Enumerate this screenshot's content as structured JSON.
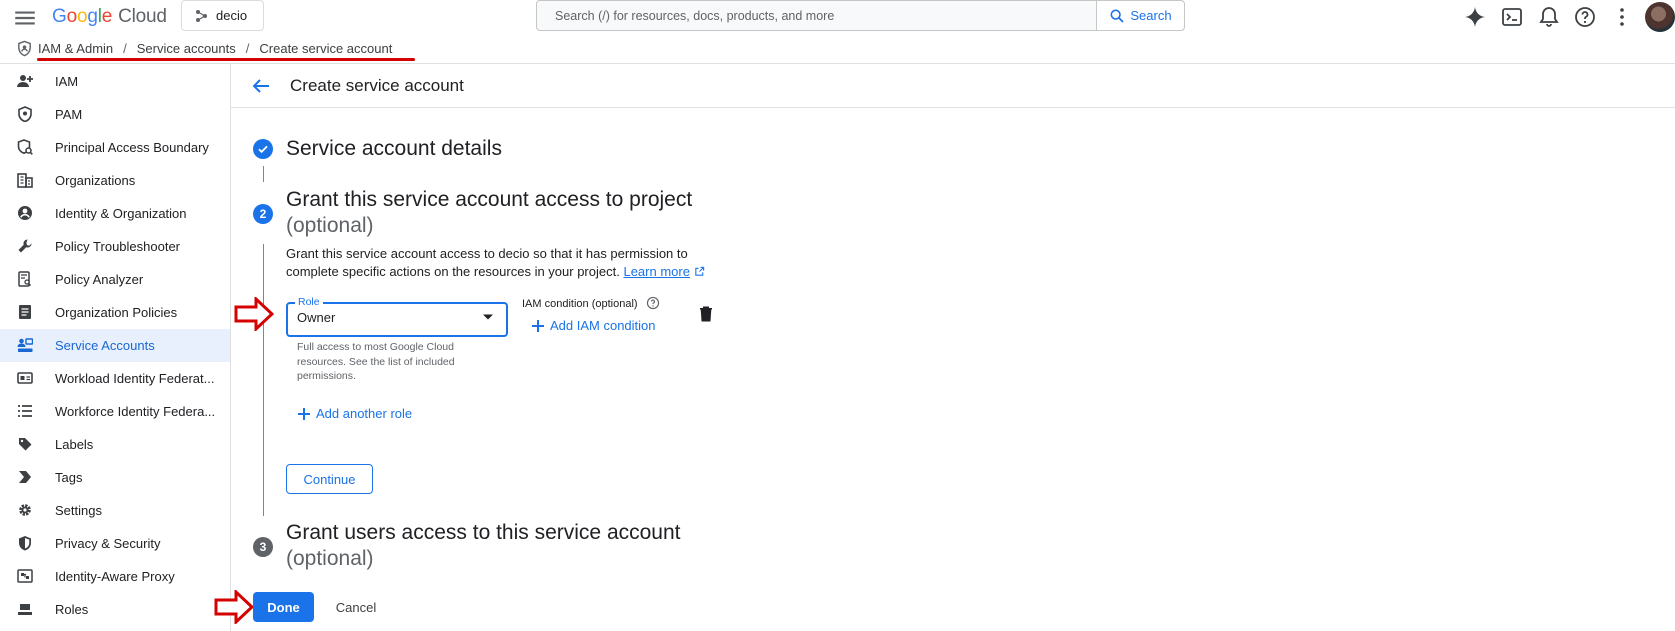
{
  "topbar": {
    "logo_google": [
      "G",
      "o",
      "o",
      "g",
      "l",
      "e"
    ],
    "logo_cloud": "Cloud",
    "project": "decio",
    "search_placeholder": "Search (/) for resources, docs, products, and more",
    "search_button": "Search",
    "icons": [
      "menu-icon",
      "gemini-icon",
      "cloud-shell-icon",
      "notifications-icon",
      "help-icon",
      "more-vert-icon"
    ]
  },
  "breadcrumb": {
    "items": [
      "IAM & Admin",
      "Service accounts",
      "Create service account"
    ],
    "separator": "/"
  },
  "sidebar": {
    "items": [
      {
        "label": "IAM",
        "icon": "person-add-icon"
      },
      {
        "label": "PAM",
        "icon": "shield-icon"
      },
      {
        "label": "Principal Access Boundary",
        "icon": "policy-icon"
      },
      {
        "label": "Organizations",
        "icon": "building-icon"
      },
      {
        "label": "Identity & Organization",
        "icon": "account-circle-icon"
      },
      {
        "label": "Policy Troubleshooter",
        "icon": "wrench-icon"
      },
      {
        "label": "Policy Analyzer",
        "icon": "document-search-icon"
      },
      {
        "label": "Organization Policies",
        "icon": "list-document-icon"
      },
      {
        "label": "Service Accounts",
        "icon": "service-account-icon",
        "active": true
      },
      {
        "label": "Workload Identity Federat...",
        "icon": "id-card-icon"
      },
      {
        "label": "Workforce Identity Federa...",
        "icon": "list-icon"
      },
      {
        "label": "Labels",
        "icon": "label-icon"
      },
      {
        "label": "Tags",
        "icon": "tag-chevron-icon"
      },
      {
        "label": "Settings",
        "icon": "gear-icon"
      },
      {
        "label": "Privacy & Security",
        "icon": "privacy-shield-icon"
      },
      {
        "label": "Identity-Aware Proxy",
        "icon": "proxy-icon"
      },
      {
        "label": "Roles",
        "icon": "roles-hat-icon"
      }
    ]
  },
  "main": {
    "title": "Create service account",
    "step1": {
      "title": "Service account details"
    },
    "step2": {
      "number": "2",
      "title": "Grant this service account access to project",
      "optional": "(optional)",
      "description": "Grant this service account access to decio so that it has permission to complete specific actions on the resources in your project.",
      "learn_more": "Learn more",
      "role_label": "Role",
      "role_value": "Owner",
      "role_help": "Full access to most Google Cloud resources. See the list of included permissions.",
      "iam_condition_label": "IAM condition (optional)",
      "add_iam_condition": "Add IAM condition",
      "add_another_role": "Add another role",
      "continue": "Continue"
    },
    "step3": {
      "number": "3",
      "title": "Grant users access to this service account",
      "optional": "(optional)"
    },
    "done": "Done",
    "cancel": "Cancel"
  },
  "colors": {
    "accent": "#1a73e8",
    "active_nav_bg": "#e8f0fe",
    "annotation_red": "#d50000"
  }
}
